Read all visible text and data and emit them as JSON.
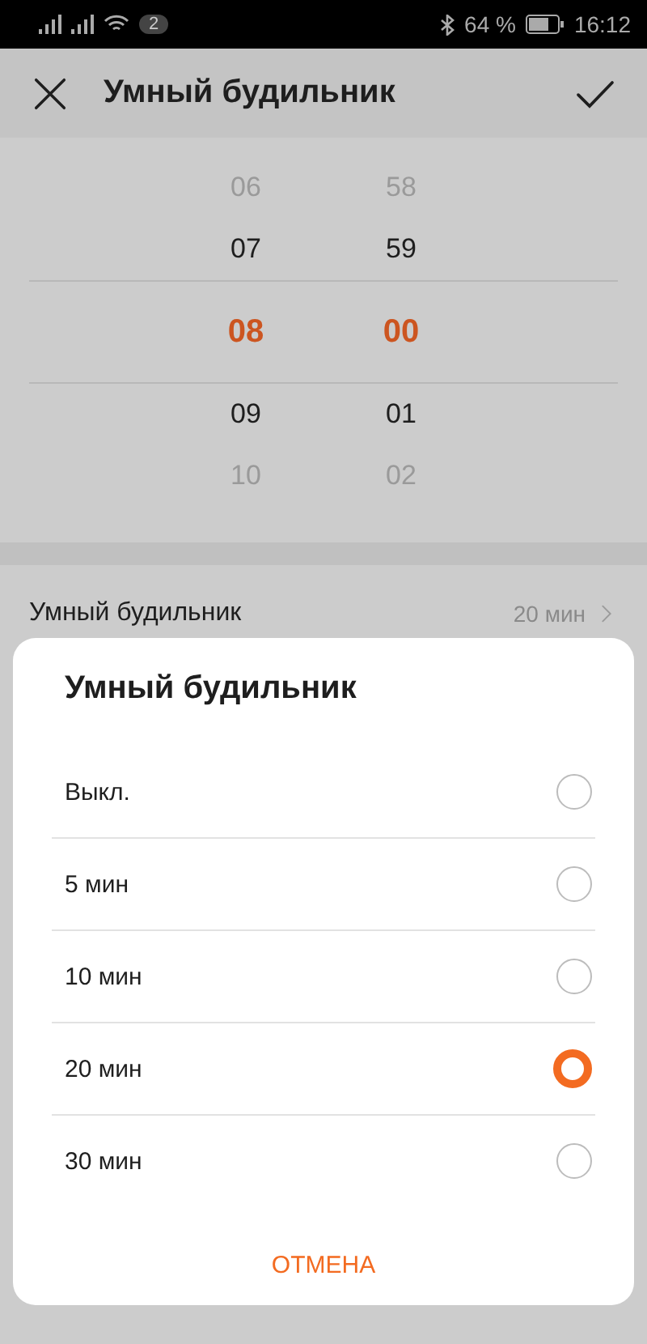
{
  "status_bar": {
    "notifications": "2",
    "battery": "64 %",
    "time": "16:12"
  },
  "header": {
    "title": "Умный будильник"
  },
  "picker": {
    "hours": [
      {
        "value": "06",
        "selected": false
      },
      {
        "value": "07",
        "selected": false
      },
      {
        "value": "08",
        "selected": true
      },
      {
        "value": "09",
        "selected": false
      },
      {
        "value": "10",
        "selected": false
      }
    ],
    "minutes": [
      {
        "value": "58",
        "selected": false
      },
      {
        "value": "59",
        "selected": false
      },
      {
        "value": "00",
        "selected": true
      },
      {
        "value": "01",
        "selected": false
      },
      {
        "value": "02",
        "selected": false
      }
    ]
  },
  "setting": {
    "label": "Умный будильник",
    "value": "20 мин"
  },
  "dialog": {
    "title": "Умный будильник",
    "options": [
      {
        "label": "Выкл.",
        "selected": false
      },
      {
        "label": "5 мин",
        "selected": false
      },
      {
        "label": "10 мин",
        "selected": false
      },
      {
        "label": "20 мин",
        "selected": true
      },
      {
        "label": "30 мин",
        "selected": false
      }
    ],
    "cancel": "ОТМЕНА"
  }
}
